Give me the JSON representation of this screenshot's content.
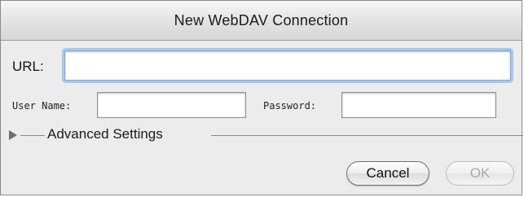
{
  "window": {
    "title": "New WebDAV Connection"
  },
  "form": {
    "url_label": "URL:",
    "url_value": "",
    "user_label": "User Name:",
    "user_value": "",
    "password_label": "Password:",
    "password_value": ""
  },
  "advanced": {
    "label": "Advanced Settings",
    "expanded": false
  },
  "buttons": {
    "cancel_label": "Cancel",
    "ok_label": "OK",
    "ok_enabled": false
  },
  "colors": {
    "focus_ring": "#a9c7ea",
    "dialog_bg": "#ececec",
    "disabled_text": "#a9a9a9"
  }
}
